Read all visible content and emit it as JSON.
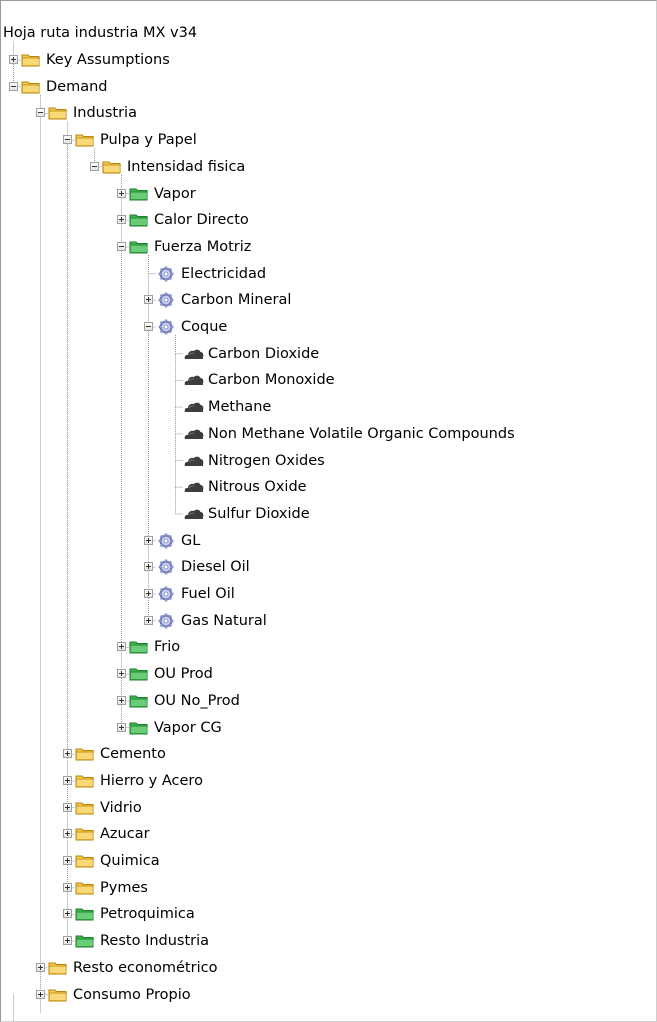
{
  "tree": [
    {
      "label": "Hoja ruta industria MX v34",
      "level": 0,
      "icon": "folder-yellow-icon",
      "expander": "none",
      "line": "none"
    },
    {
      "label": "Key Assumptions",
      "level": 1,
      "icon": "folder-yellow-icon",
      "expander": "collapsed",
      "line": "mid"
    },
    {
      "label": "Demand",
      "level": 1,
      "icon": "folder-yellow-icon",
      "expander": "expanded",
      "line": "mid"
    },
    {
      "label": "Industria",
      "level": 2,
      "icon": "folder-yellow-icon",
      "expander": "expanded",
      "line": "mid"
    },
    {
      "label": "Pulpa y Papel",
      "level": 3,
      "icon": "folder-yellow-icon",
      "expander": "expanded",
      "line": "mid"
    },
    {
      "label": "Intensidad fisica",
      "level": 4,
      "icon": "folder-yellow-icon",
      "expander": "expanded",
      "line": "last"
    },
    {
      "label": "Vapor",
      "level": 5,
      "icon": "folder-green-icon",
      "expander": "collapsed",
      "line": "mid"
    },
    {
      "label": "Calor Directo",
      "level": 5,
      "icon": "folder-green-icon",
      "expander": "collapsed",
      "line": "mid"
    },
    {
      "label": "Fuerza Motriz",
      "level": 5,
      "icon": "folder-green-icon",
      "expander": "expanded",
      "line": "mid"
    },
    {
      "label": "Electricidad",
      "level": 6,
      "icon": "gear-icon",
      "expander": "none",
      "line": "mid"
    },
    {
      "label": "Carbon Mineral",
      "level": 6,
      "icon": "gear-icon",
      "expander": "collapsed",
      "line": "mid"
    },
    {
      "label": "Coque",
      "level": 6,
      "icon": "gear-icon",
      "expander": "expanded",
      "line": "mid"
    },
    {
      "label": "Carbon Dioxide",
      "level": 7,
      "icon": "cloud-icon",
      "expander": "none",
      "line": "mid"
    },
    {
      "label": "Carbon Monoxide",
      "level": 7,
      "icon": "cloud-icon",
      "expander": "none",
      "line": "mid"
    },
    {
      "label": "Methane",
      "level": 7,
      "icon": "cloud-icon",
      "expander": "none",
      "line": "mid"
    },
    {
      "label": "Non Methane Volatile Organic Compounds",
      "level": 7,
      "icon": "cloud-icon",
      "expander": "none",
      "line": "mid"
    },
    {
      "label": "Nitrogen Oxides",
      "level": 7,
      "icon": "cloud-icon",
      "expander": "none",
      "line": "mid"
    },
    {
      "label": "Nitrous Oxide",
      "level": 7,
      "icon": "cloud-icon",
      "expander": "none",
      "line": "mid"
    },
    {
      "label": "Sulfur Dioxide",
      "level": 7,
      "icon": "cloud-icon",
      "expander": "none",
      "line": "last"
    },
    {
      "label": "GL",
      "level": 6,
      "icon": "gear-icon",
      "expander": "collapsed",
      "line": "mid"
    },
    {
      "label": "Diesel Oil",
      "level": 6,
      "icon": "gear-icon",
      "expander": "collapsed",
      "line": "mid"
    },
    {
      "label": "Fuel Oil",
      "level": 6,
      "icon": "gear-icon",
      "expander": "collapsed",
      "line": "mid"
    },
    {
      "label": "Gas Natural",
      "level": 6,
      "icon": "gear-icon",
      "expander": "collapsed",
      "line": "last"
    },
    {
      "label": "Frio",
      "level": 5,
      "icon": "folder-green-icon",
      "expander": "collapsed",
      "line": "mid"
    },
    {
      "label": "OU Prod",
      "level": 5,
      "icon": "folder-green-icon",
      "expander": "collapsed",
      "line": "mid"
    },
    {
      "label": "OU No_Prod",
      "level": 5,
      "icon": "folder-green-icon",
      "expander": "collapsed",
      "line": "mid"
    },
    {
      "label": "Vapor CG",
      "level": 5,
      "icon": "folder-green-icon",
      "expander": "collapsed",
      "line": "last"
    },
    {
      "label": "Cemento",
      "level": 3,
      "icon": "folder-yellow-icon",
      "expander": "collapsed",
      "line": "mid"
    },
    {
      "label": "Hierro y Acero",
      "level": 3,
      "icon": "folder-yellow-icon",
      "expander": "collapsed",
      "line": "mid"
    },
    {
      "label": "Vidrio",
      "level": 3,
      "icon": "folder-yellow-icon",
      "expander": "collapsed",
      "line": "mid"
    },
    {
      "label": "Azucar",
      "level": 3,
      "icon": "folder-yellow-icon",
      "expander": "collapsed",
      "line": "mid"
    },
    {
      "label": "Quimica",
      "level": 3,
      "icon": "folder-yellow-icon",
      "expander": "collapsed",
      "line": "mid"
    },
    {
      "label": "Pymes",
      "level": 3,
      "icon": "folder-yellow-icon",
      "expander": "collapsed",
      "line": "mid"
    },
    {
      "label": "Petroquimica",
      "level": 3,
      "icon": "folder-green-icon",
      "expander": "collapsed",
      "line": "mid"
    },
    {
      "label": "Resto Industria",
      "level": 3,
      "icon": "folder-green-icon",
      "expander": "collapsed",
      "line": "last"
    },
    {
      "label": "Resto econométrico",
      "level": 2,
      "icon": "folder-yellow-icon",
      "expander": "collapsed",
      "line": "mid"
    },
    {
      "label": "Consumo Propio",
      "level": 2,
      "icon": "folder-yellow-icon",
      "expander": "collapsed",
      "line": "mid"
    }
  ],
  "colors": {
    "folder_yellow": "#f2c94c",
    "folder_green": "#3cb44b",
    "gear": "#8a97cf",
    "cloud": "#3d3d3d",
    "tree_line": "#9a9a9a"
  }
}
